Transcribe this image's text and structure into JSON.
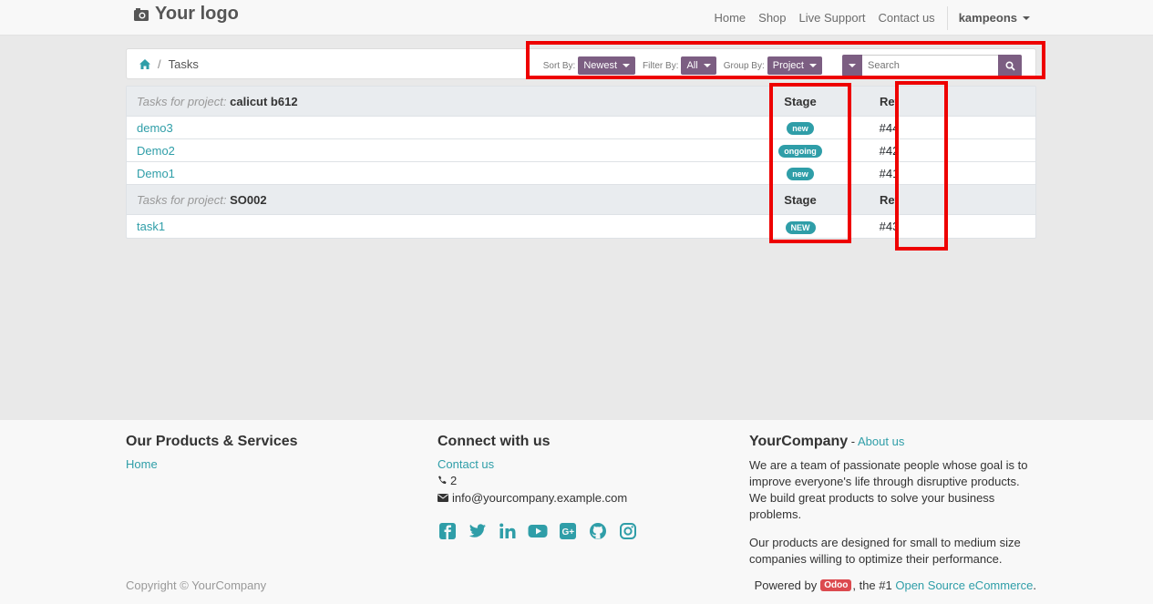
{
  "navbar": {
    "logo_text": "Your logo",
    "links": [
      "Home",
      "Shop",
      "Live Support",
      "Contact us"
    ],
    "user": "kampeons"
  },
  "breadcrumb": {
    "current": "Tasks"
  },
  "filters": {
    "sort_label": "Sort By:",
    "sort_value": "Newest",
    "filter_label": "Filter By:",
    "filter_value": "All",
    "group_label": "Group By:",
    "group_value": "Project",
    "search_placeholder": "Search"
  },
  "table": {
    "stage_header": "Stage",
    "ref_header": "Ref",
    "group_prefix": "Tasks for project:",
    "groups": [
      {
        "project": "calicut b612",
        "tasks": [
          {
            "name": "demo3",
            "stage": "new",
            "ref": "#44"
          },
          {
            "name": "Demo2",
            "stage": "ongoing",
            "ref": "#42"
          },
          {
            "name": "Demo1",
            "stage": "new",
            "ref": "#41"
          }
        ]
      },
      {
        "project": "SO002",
        "tasks": [
          {
            "name": "task1",
            "stage": "NEW",
            "ref": "#43"
          }
        ]
      }
    ]
  },
  "footer": {
    "products_title": "Our Products & Services",
    "products_home": "Home",
    "connect_title": "Connect with us",
    "contact_link": "Contact us",
    "phone": "2",
    "email": "info@yourcompany.example.com",
    "company_name": "YourCompany",
    "about_sep": " - ",
    "about_link": "About us",
    "about_p1": "We are a team of passionate people whose goal is to improve everyone's life through disruptive products. We build great products to solve your business problems.",
    "about_p2": "Our products are designed for small to medium size companies willing to optimize their performance.",
    "copyright": "Copyright © YourCompany",
    "powered_prefix": "Powered by",
    "odoo": "Odoo",
    "powered_mid": ", the #1",
    "powered_link": "Open Source eCommerce",
    "powered_end": "."
  },
  "colors": {
    "accent": "#2f9ea8",
    "button": "#7c5e82",
    "highlight": "#ee0000"
  }
}
